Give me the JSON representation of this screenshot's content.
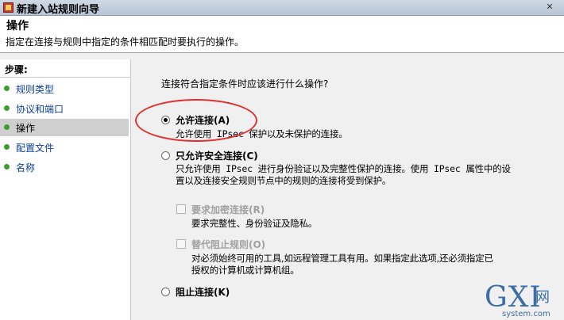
{
  "window": {
    "title": "新建入站规则向导",
    "close_glyph": "✕"
  },
  "header": {
    "title": "操作",
    "subtitle": "指定在连接与规则中指定的条件相匹配时要执行的操作。"
  },
  "sidebar": {
    "steps_label": "步骤:",
    "items": [
      {
        "label": "规则类型"
      },
      {
        "label": "协议和端口"
      },
      {
        "label": "操作"
      },
      {
        "label": "配置文件"
      },
      {
        "label": "名称"
      }
    ],
    "active_index": 2
  },
  "main": {
    "question": "连接符合指定条件时应该进行什么操作?",
    "allow": {
      "label": "允许连接(A)",
      "desc": "允许使用 IPsec 保护以及未保护的连接。",
      "selected": true
    },
    "allow_secure": {
      "label": "只允许安全连接(C)",
      "desc_line1": "只允许使用 IPsec 进行身份验证以及完整性保护的连接。使用 IPsec 属性中的设",
      "desc_line2": "置以及连接安全规则节点中的规则的连接将受到保护。",
      "selected": false,
      "require_encryption": {
        "label": "要求加密连接(R)",
        "desc": "要求完整性、身份验证及隐私。",
        "enabled": false
      },
      "override_block": {
        "label": "替代阻止规则(O)",
        "desc_line1": "对必须始终可用的工具,如远程管理工具有用。如果指定此选项,还必须指定已",
        "desc_line2": "授权的计算机或计算机组。",
        "enabled": false
      }
    },
    "block": {
      "label": "阻止连接(K)",
      "selected": false
    }
  },
  "watermark": {
    "logo": "GXI",
    "cn": "网",
    "url": "system.com"
  },
  "colors": {
    "step_dot": "#3c9e2c",
    "link": "#0b3f99",
    "highlight": "#e03030"
  }
}
